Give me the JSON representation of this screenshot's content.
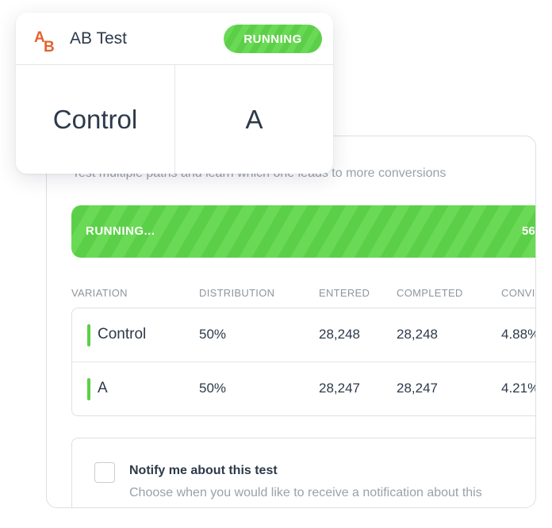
{
  "card": {
    "title": "AB Test",
    "status_badge": "RUNNING",
    "variants": [
      "Control",
      "A"
    ],
    "logo_letters": "AB"
  },
  "panel": {
    "subtitle": "Test multiple paths and learn which one leads to more conversions",
    "progress": {
      "label": "RUNNING...",
      "percent_text": "56"
    },
    "table": {
      "headers": [
        "VARIATION",
        "DISTRIBUTION",
        "ENTERED",
        "COMPLETED",
        "CONVI"
      ],
      "rows": [
        {
          "name": "Control",
          "distribution": "50%",
          "entered": "28,248",
          "completed": "28,248",
          "conversion": "4.88%"
        },
        {
          "name": "A",
          "distribution": "50%",
          "entered": "28,247",
          "completed": "28,247",
          "conversion": "4.21%"
        }
      ]
    },
    "notify": {
      "title": "Notify me about this test",
      "description": "Choose when you would like to receive a notification about this",
      "checked": false
    }
  },
  "colors": {
    "accent_green": "#5ccf48",
    "logo_orange": "#e2632b",
    "text_dark": "#2d3a4a",
    "text_muted": "#9aa1a9"
  }
}
